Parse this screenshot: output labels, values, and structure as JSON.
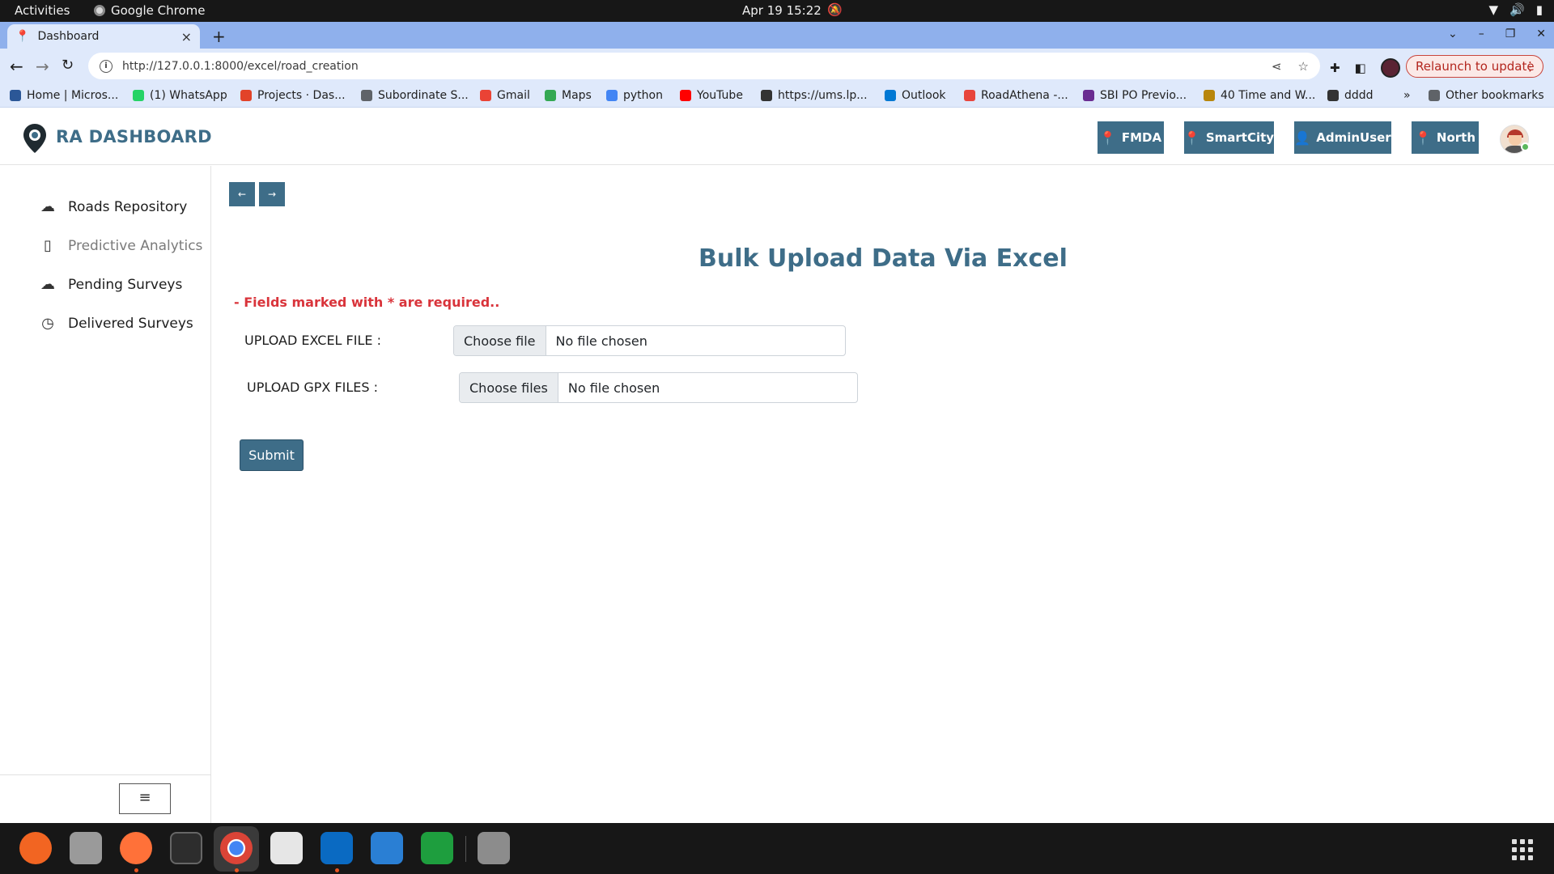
{
  "system_bar": {
    "activities": "Activities",
    "app_name": "Google Chrome",
    "clock": "Apr 19  15:22"
  },
  "browser": {
    "tab_title": "Dashboard",
    "url": "http://127.0.0.1:8000/excel/road_creation",
    "relaunch_label": "Relaunch to update",
    "bookmarks": [
      {
        "label": "Home | Micros...",
        "color": "#2b5797"
      },
      {
        "label": "(1) WhatsApp",
        "color": "#25d366"
      },
      {
        "label": "Projects · Das...",
        "color": "#e24329"
      },
      {
        "label": "Subordinate S...",
        "color": "#5f6368"
      },
      {
        "label": "Gmail",
        "color": "#ea4335"
      },
      {
        "label": "Maps",
        "color": "#34a853"
      },
      {
        "label": "python",
        "color": "#4285f4"
      },
      {
        "label": "YouTube",
        "color": "#ff0000"
      },
      {
        "label": "https://ums.lp...",
        "color": "#333333"
      },
      {
        "label": "Outlook",
        "color": "#0078d4"
      },
      {
        "label": "RoadAthena -...",
        "color": "#e8453c"
      },
      {
        "label": "SBI PO Previo...",
        "color": "#6a2c91"
      },
      {
        "label": "40 Time and W...",
        "color": "#b8860b"
      },
      {
        "label": "dddd",
        "color": "#333333"
      }
    ],
    "bookmarks_overflow": "»",
    "other_bookmarks": "Other bookmarks"
  },
  "app": {
    "brand": "RA DASHBOARD",
    "header_buttons": [
      {
        "label": "FMDA",
        "icon": "map-pin-icon"
      },
      {
        "label": "SmartCity",
        "icon": "map-pin-icon"
      },
      {
        "label": "AdminUser",
        "icon": "user-check-icon"
      },
      {
        "label": "North",
        "icon": "map-pin-icon"
      }
    ],
    "sidebar": [
      {
        "label": "Roads Repository",
        "icon": "cloud-upload-icon"
      },
      {
        "label": "Predictive Analytics",
        "icon": "map-book-icon"
      },
      {
        "label": "Pending Surveys",
        "icon": "cloud-upload-icon"
      },
      {
        "label": "Delivered Surveys",
        "icon": "clock-icon"
      }
    ],
    "nav": {
      "back": "←",
      "forward": "→"
    },
    "page_title": "Bulk Upload Data Via Excel",
    "required_note": "- Fields marked with * are required..",
    "form": {
      "excel_label": "UPLOAD EXCEL FILE :",
      "excel_button": "Choose file",
      "excel_status": "No file chosen",
      "gpx_label": "UPLOAD GPX FILES :",
      "gpx_button": "Choose files",
      "gpx_status": "No file chosen",
      "submit": "Submit"
    },
    "menu_toggle": "≡"
  },
  "colors": {
    "accent": "#3e6d88",
    "required": "#d9343b"
  }
}
